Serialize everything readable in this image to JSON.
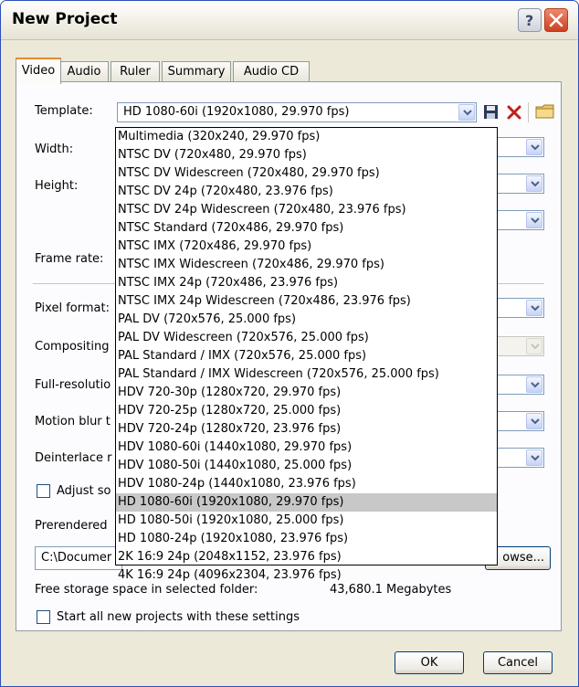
{
  "window": {
    "title": "New Project"
  },
  "tabs": [
    {
      "label": "Video",
      "active": true
    },
    {
      "label": "Audio"
    },
    {
      "label": "Ruler"
    },
    {
      "label": "Summary"
    },
    {
      "label": "Audio CD"
    }
  ],
  "video": {
    "template_label": "Template:",
    "template_value": "HD 1080-60i (1920x1080, 29.970 fps)",
    "width_label": "Width:",
    "height_label": "Height:",
    "frame_rate_label": "Frame rate:",
    "pixel_format_label": "Pixel format:",
    "compositing_label": "Compositing",
    "full_resolution_label": "Full-resolutio",
    "motion_blur_label": "Motion blur t",
    "deinterlace_label": "Deinterlace r",
    "adjust_label": "Adjust so",
    "prerendered_label": "Prerendered",
    "folder_path": "C:\\Documer",
    "browse_label": "owse...",
    "free_space_label": "Free storage space in selected folder:",
    "free_space_value": "43,680.1 Megabytes",
    "start_all_label": "Start all new projects with these settings"
  },
  "template_options": [
    "Multimedia (320x240, 29.970 fps)",
    "NTSC DV (720x480, 29.970 fps)",
    "NTSC DV Widescreen (720x480, 29.970 fps)",
    "NTSC DV 24p (720x480, 23.976 fps)",
    "NTSC DV 24p Widescreen (720x480, 23.976 fps)",
    "NTSC Standard (720x486, 29.970 fps)",
    "NTSC IMX (720x486, 29.970 fps)",
    "NTSC IMX Widescreen (720x486, 29.970 fps)",
    "NTSC IMX 24p (720x486, 23.976 fps)",
    "NTSC IMX 24p Widescreen (720x486, 23.976 fps)",
    "PAL DV (720x576, 25.000 fps)",
    "PAL DV Widescreen (720x576, 25.000 fps)",
    "PAL Standard / IMX (720x576, 25.000 fps)",
    "PAL Standard / IMX Widescreen (720x576, 25.000 fps)",
    "HDV 720-30p (1280x720, 29.970 fps)",
    "HDV 720-25p (1280x720, 25.000 fps)",
    "HDV 720-24p (1280x720, 23.976 fps)",
    "HDV 1080-60i (1440x1080, 29.970 fps)",
    "HDV 1080-50i (1440x1080, 25.000 fps)",
    "HDV 1080-24p (1440x1080, 23.976 fps)",
    "HD 1080-60i (1920x1080, 29.970 fps)",
    "HD 1080-50i (1920x1080, 25.000 fps)",
    "HD 1080-24p (1920x1080, 23.976 fps)",
    "2K 16:9 24p (2048x1152, 23.976 fps)",
    "4K 16:9 24p (4096x2304, 23.976 fps)"
  ],
  "selected_template_index": 20,
  "buttons": {
    "ok": "OK",
    "cancel": "Cancel"
  },
  "colors": {
    "title_gradient": "#e6e3d4",
    "accent_tab": "#e68b2c",
    "delete_red": "#c0201a",
    "selection": "#c8c8c8"
  },
  "icons": [
    "help-icon",
    "close-icon",
    "save-icon",
    "delete-icon",
    "folder-icon",
    "chevron-down-icon"
  ]
}
